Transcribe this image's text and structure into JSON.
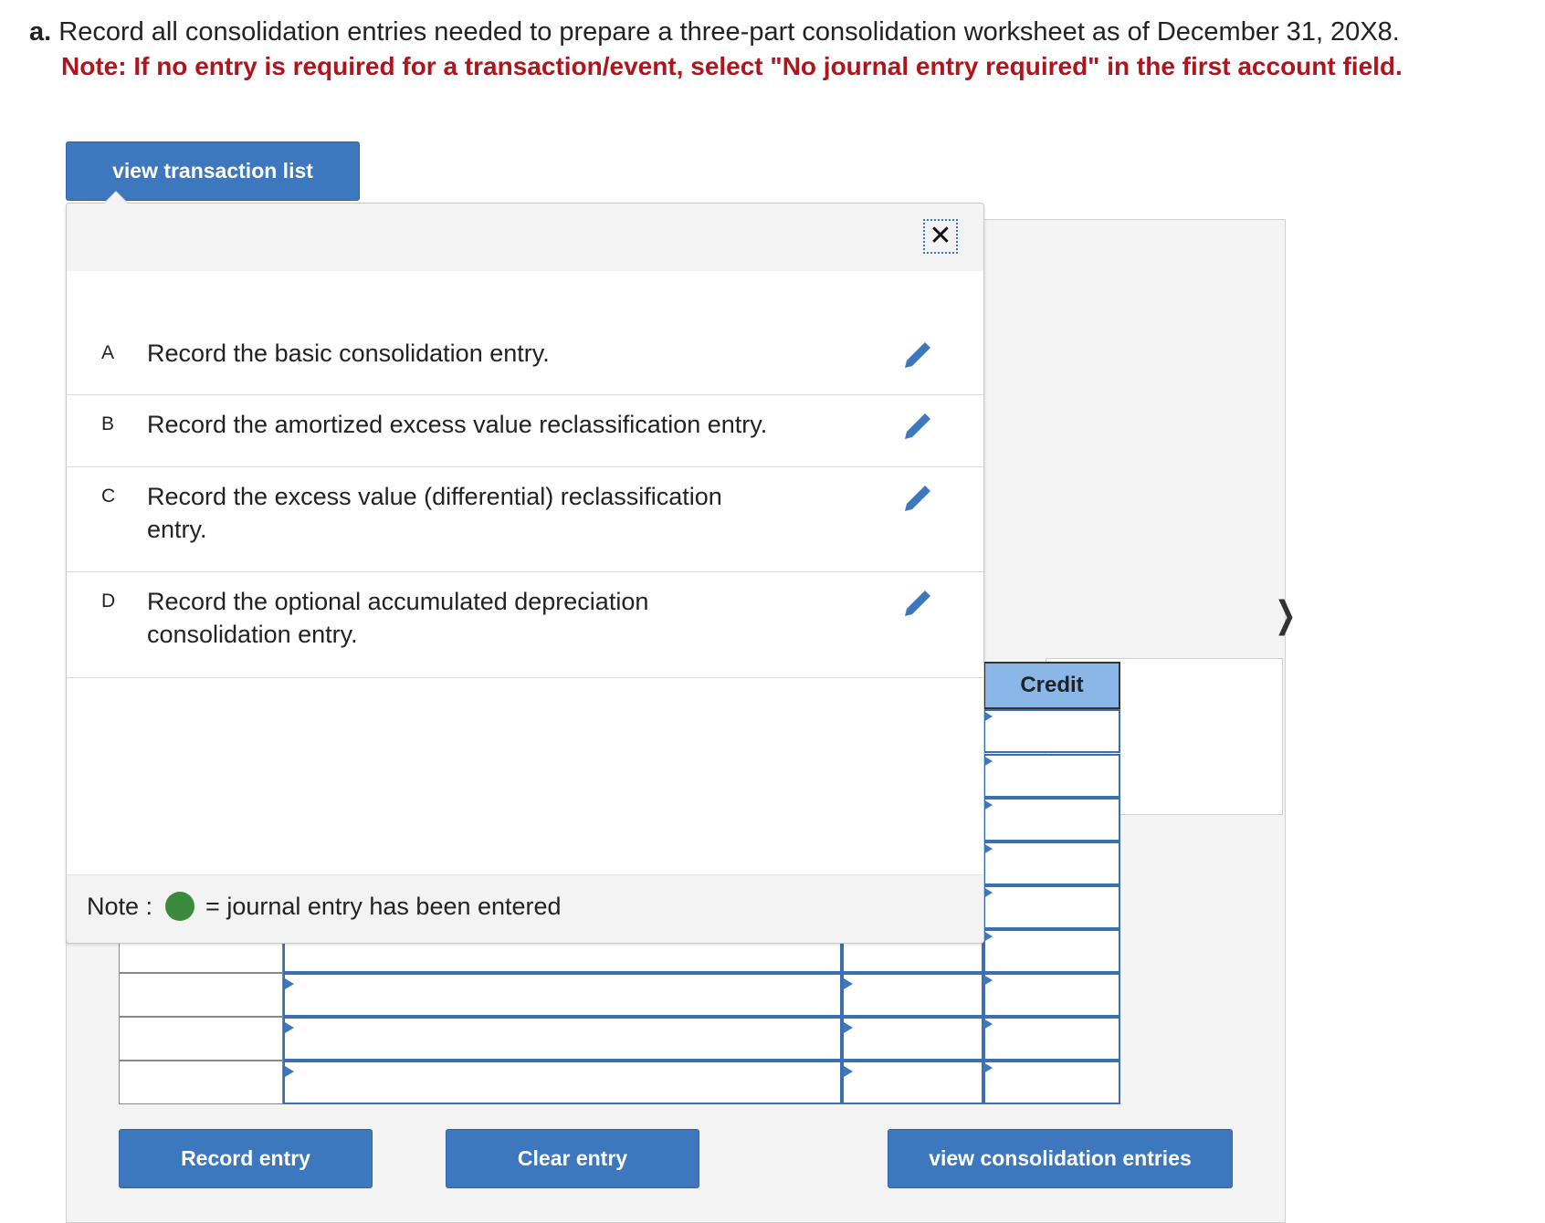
{
  "question": {
    "letter": "a.",
    "prompt": "Record all consolidation entries needed to prepare a three-part consolidation worksheet as of December 31, 20X8.",
    "note": "Note: If no entry is required for a transaction/event, select \"No journal entry required\" in the first account field."
  },
  "buttons": {
    "view_transaction_list": "view transaction list",
    "record_entry": "Record entry",
    "clear_entry": "Clear entry",
    "view_consolidation_entries": "view consolidation entries"
  },
  "popup": {
    "close_icon": "close-icon",
    "transactions": [
      {
        "letter": "A",
        "text": "Record the basic consolidation entry."
      },
      {
        "letter": "B",
        "text": "Record the amortized excess value reclassification entry."
      },
      {
        "letter": "C",
        "text": "Record the excess value (differential) reclassification entry."
      },
      {
        "letter": "D",
        "text": "Record the optional accumulated depreciation consolidation entry."
      }
    ],
    "footer": {
      "note_label": "Note :",
      "legend_text": "= journal entry has been entered",
      "dot_color": "#3b8a3d"
    }
  },
  "worksheet": {
    "credit_header": "Credit",
    "accent_color": "#3d78bf"
  }
}
